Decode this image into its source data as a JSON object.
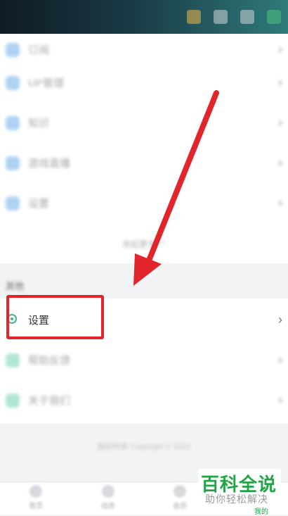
{
  "top_list": [
    {
      "label": "订阅",
      "icon": "bookmark-icon",
      "color": "#5aa6e8"
    },
    {
      "label": "UP管理",
      "icon": "folder-icon",
      "color": "#5aa6e8"
    },
    {
      "label": "知识",
      "icon": "book-icon",
      "color": "#5aa6e8"
    },
    {
      "label": "游戏直播",
      "icon": "globe-icon",
      "color": "#5aa6e8"
    },
    {
      "label": "设置",
      "icon": "cloud-icon",
      "color": "#5aa6e8"
    }
  ],
  "collapse_label": "收起更多 ⌃",
  "section_title": "其他",
  "bottom_list": [
    {
      "label": "设置",
      "icon": "gear-icon",
      "color": "#3bb58d"
    },
    {
      "label": "帮助反馈",
      "icon": "help-icon",
      "color": "#3bb58d"
    },
    {
      "label": "关于我们",
      "icon": "info-icon",
      "color": "#3bb58d"
    }
  ],
  "footer_text": "版权所有 Copyright © 2021",
  "nav": [
    {
      "label": "首页"
    },
    {
      "label": "动态"
    },
    {
      "label": "会员"
    },
    {
      "label": "我的"
    }
  ],
  "watermark": {
    "title": "百科全说",
    "subtitle": "助你轻松解决",
    "tab_label": "我的"
  },
  "accent_color": "#e2242b"
}
